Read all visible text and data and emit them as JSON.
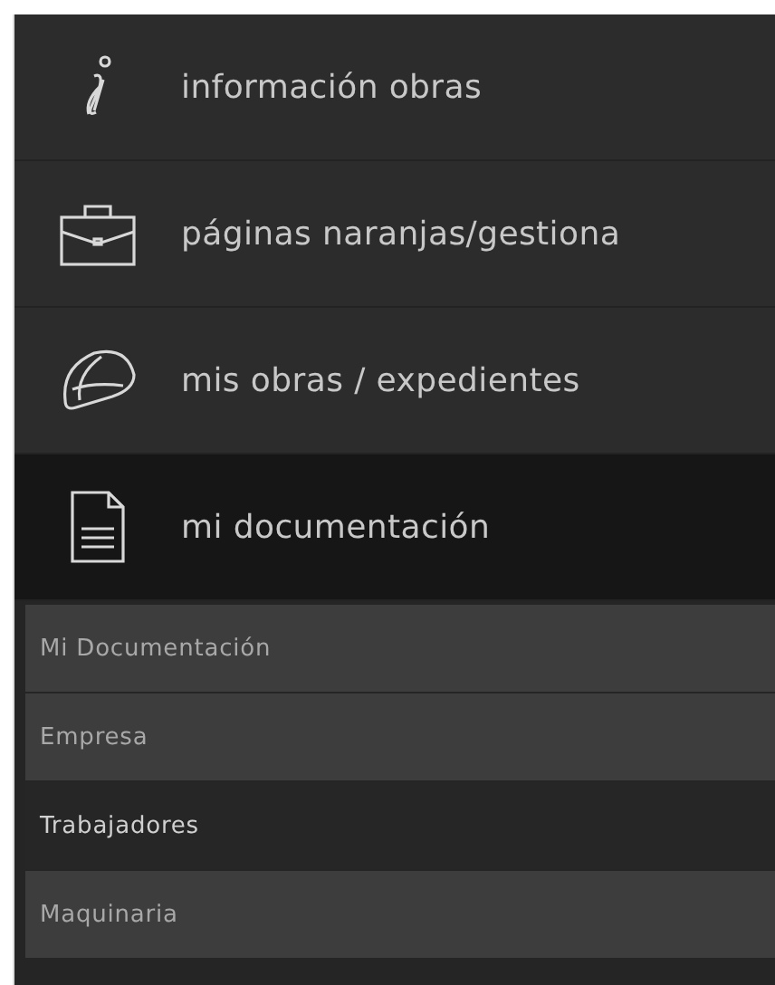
{
  "menu": [
    {
      "label": "información obras",
      "selected": false
    },
    {
      "label": "páginas naranjas/gestiona",
      "selected": false
    },
    {
      "label": "mis obras / expedientes",
      "selected": false
    },
    {
      "label": "mi documentación",
      "selected": true
    }
  ],
  "submenu": [
    {
      "label": "Mi Documentación",
      "selected": false
    },
    {
      "label": "Empresa",
      "selected": false
    },
    {
      "label": "Trabajadores",
      "selected": true
    },
    {
      "label": "Maquinaria",
      "selected": false
    }
  ]
}
